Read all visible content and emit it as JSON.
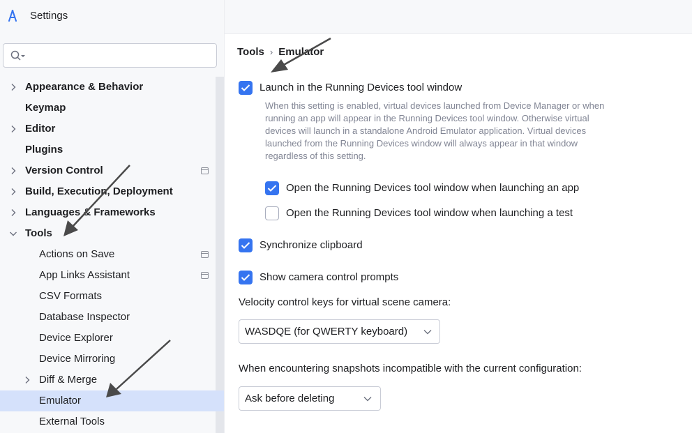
{
  "window": {
    "title": "Settings"
  },
  "search": {
    "placeholder": ""
  },
  "sidebar": {
    "items": [
      {
        "label": "Appearance & Behavior",
        "bold": true,
        "chevron": "right",
        "badge": false
      },
      {
        "label": "Keymap",
        "bold": true,
        "chevron": "none",
        "badge": false
      },
      {
        "label": "Editor",
        "bold": true,
        "chevron": "right",
        "badge": false
      },
      {
        "label": "Plugins",
        "bold": true,
        "chevron": "none",
        "badge": false
      },
      {
        "label": "Version Control",
        "bold": true,
        "chevron": "right",
        "badge": true
      },
      {
        "label": "Build, Execution, Deployment",
        "bold": true,
        "chevron": "right",
        "badge": false
      },
      {
        "label": "Languages & Frameworks",
        "bold": true,
        "chevron": "right",
        "badge": false
      },
      {
        "label": "Tools",
        "bold": true,
        "chevron": "down",
        "badge": false
      },
      {
        "label": "Actions on Save",
        "bold": false,
        "chevron": "none",
        "badge": true
      },
      {
        "label": "App Links Assistant",
        "bold": false,
        "chevron": "none",
        "badge": true
      },
      {
        "label": "CSV Formats",
        "bold": false,
        "chevron": "none",
        "badge": false
      },
      {
        "label": "Database Inspector",
        "bold": false,
        "chevron": "none",
        "badge": false
      },
      {
        "label": "Device Explorer",
        "bold": false,
        "chevron": "none",
        "badge": false
      },
      {
        "label": "Device Mirroring",
        "bold": false,
        "chevron": "none",
        "badge": false
      },
      {
        "label": "Diff & Merge",
        "bold": false,
        "chevron": "right",
        "badge": false
      },
      {
        "label": "Emulator",
        "bold": false,
        "chevron": "none",
        "badge": false,
        "selected": true
      },
      {
        "label": "External Tools",
        "bold": false,
        "chevron": "none",
        "badge": false
      }
    ]
  },
  "breadcrumb": {
    "parent": "Tools",
    "separator": "›",
    "current": "Emulator"
  },
  "settings": {
    "launch_in_running_devices": {
      "label": "Launch in the Running Devices tool window",
      "checked": true
    },
    "launch_description": "When this setting is enabled, virtual devices launched from Device Manager or when running an app will appear in the Running Devices tool window. Otherwise virtual devices will launch in a standalone Android Emulator application. Virtual devices launched from the Running Devices window will always appear in that window regardless of this setting.",
    "open_when_launching_app": {
      "label": "Open the Running Devices tool window when launching an app",
      "checked": true
    },
    "open_when_launching_test": {
      "label": "Open the Running Devices tool window when launching a test",
      "checked": false
    },
    "synchronize_clipboard": {
      "label": "Synchronize clipboard",
      "checked": true
    },
    "show_camera_prompts": {
      "label": "Show camera control prompts",
      "checked": true
    },
    "velocity_keys": {
      "label": "Velocity control keys for virtual scene camera:",
      "value": "WASDQE (for QWERTY keyboard)"
    },
    "snapshots": {
      "label": "When encountering snapshots incompatible with the current configuration:",
      "value": "Ask before deleting"
    }
  },
  "colors": {
    "accent": "#3574f0",
    "selection": "#d5e1fb",
    "annotation_arrow": "#4a4a4a"
  }
}
